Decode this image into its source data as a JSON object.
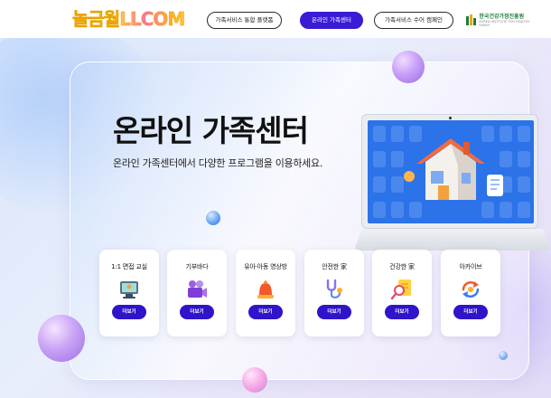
{
  "header": {
    "logo_text": "놀금월LLCOM",
    "nav": [
      {
        "label": "가족서비스 통합 플랫폼",
        "active": false
      },
      {
        "label": "온라인 가족센터",
        "active": true
      },
      {
        "label": "가족서비스 수어 캠페인",
        "active": false
      }
    ],
    "partner_name": "한국건강가정진흥원",
    "partner_sub": "KOREA INSTITUTE FOR HEALTHY FAMILY"
  },
  "hero": {
    "title": "온라인 가족센터",
    "subtitle": "온라인 가족센터에서 다양한 프로그램을 이용하세요."
  },
  "cards": [
    {
      "label": "1:1 면접 교실",
      "icon": "monitor-icon",
      "button": "더보기"
    },
    {
      "label": "기부바다",
      "icon": "video-camera-icon",
      "button": "더보기"
    },
    {
      "label": "유아·아동 영상방",
      "icon": "bell-icon",
      "button": "더보기"
    },
    {
      "label": "안전한 家",
      "icon": "stethoscope-icon",
      "button": "더보기"
    },
    {
      "label": "건강한 家",
      "icon": "magnifier-document-icon",
      "button": "더보기"
    },
    {
      "label": "아카이브",
      "icon": "refresh-icon",
      "button": "더보기"
    }
  ],
  "colors": {
    "primary": "#3a1bd6",
    "button": "#2f14c9",
    "screen": "#2c72e8",
    "partner": "#1f7a3a"
  }
}
